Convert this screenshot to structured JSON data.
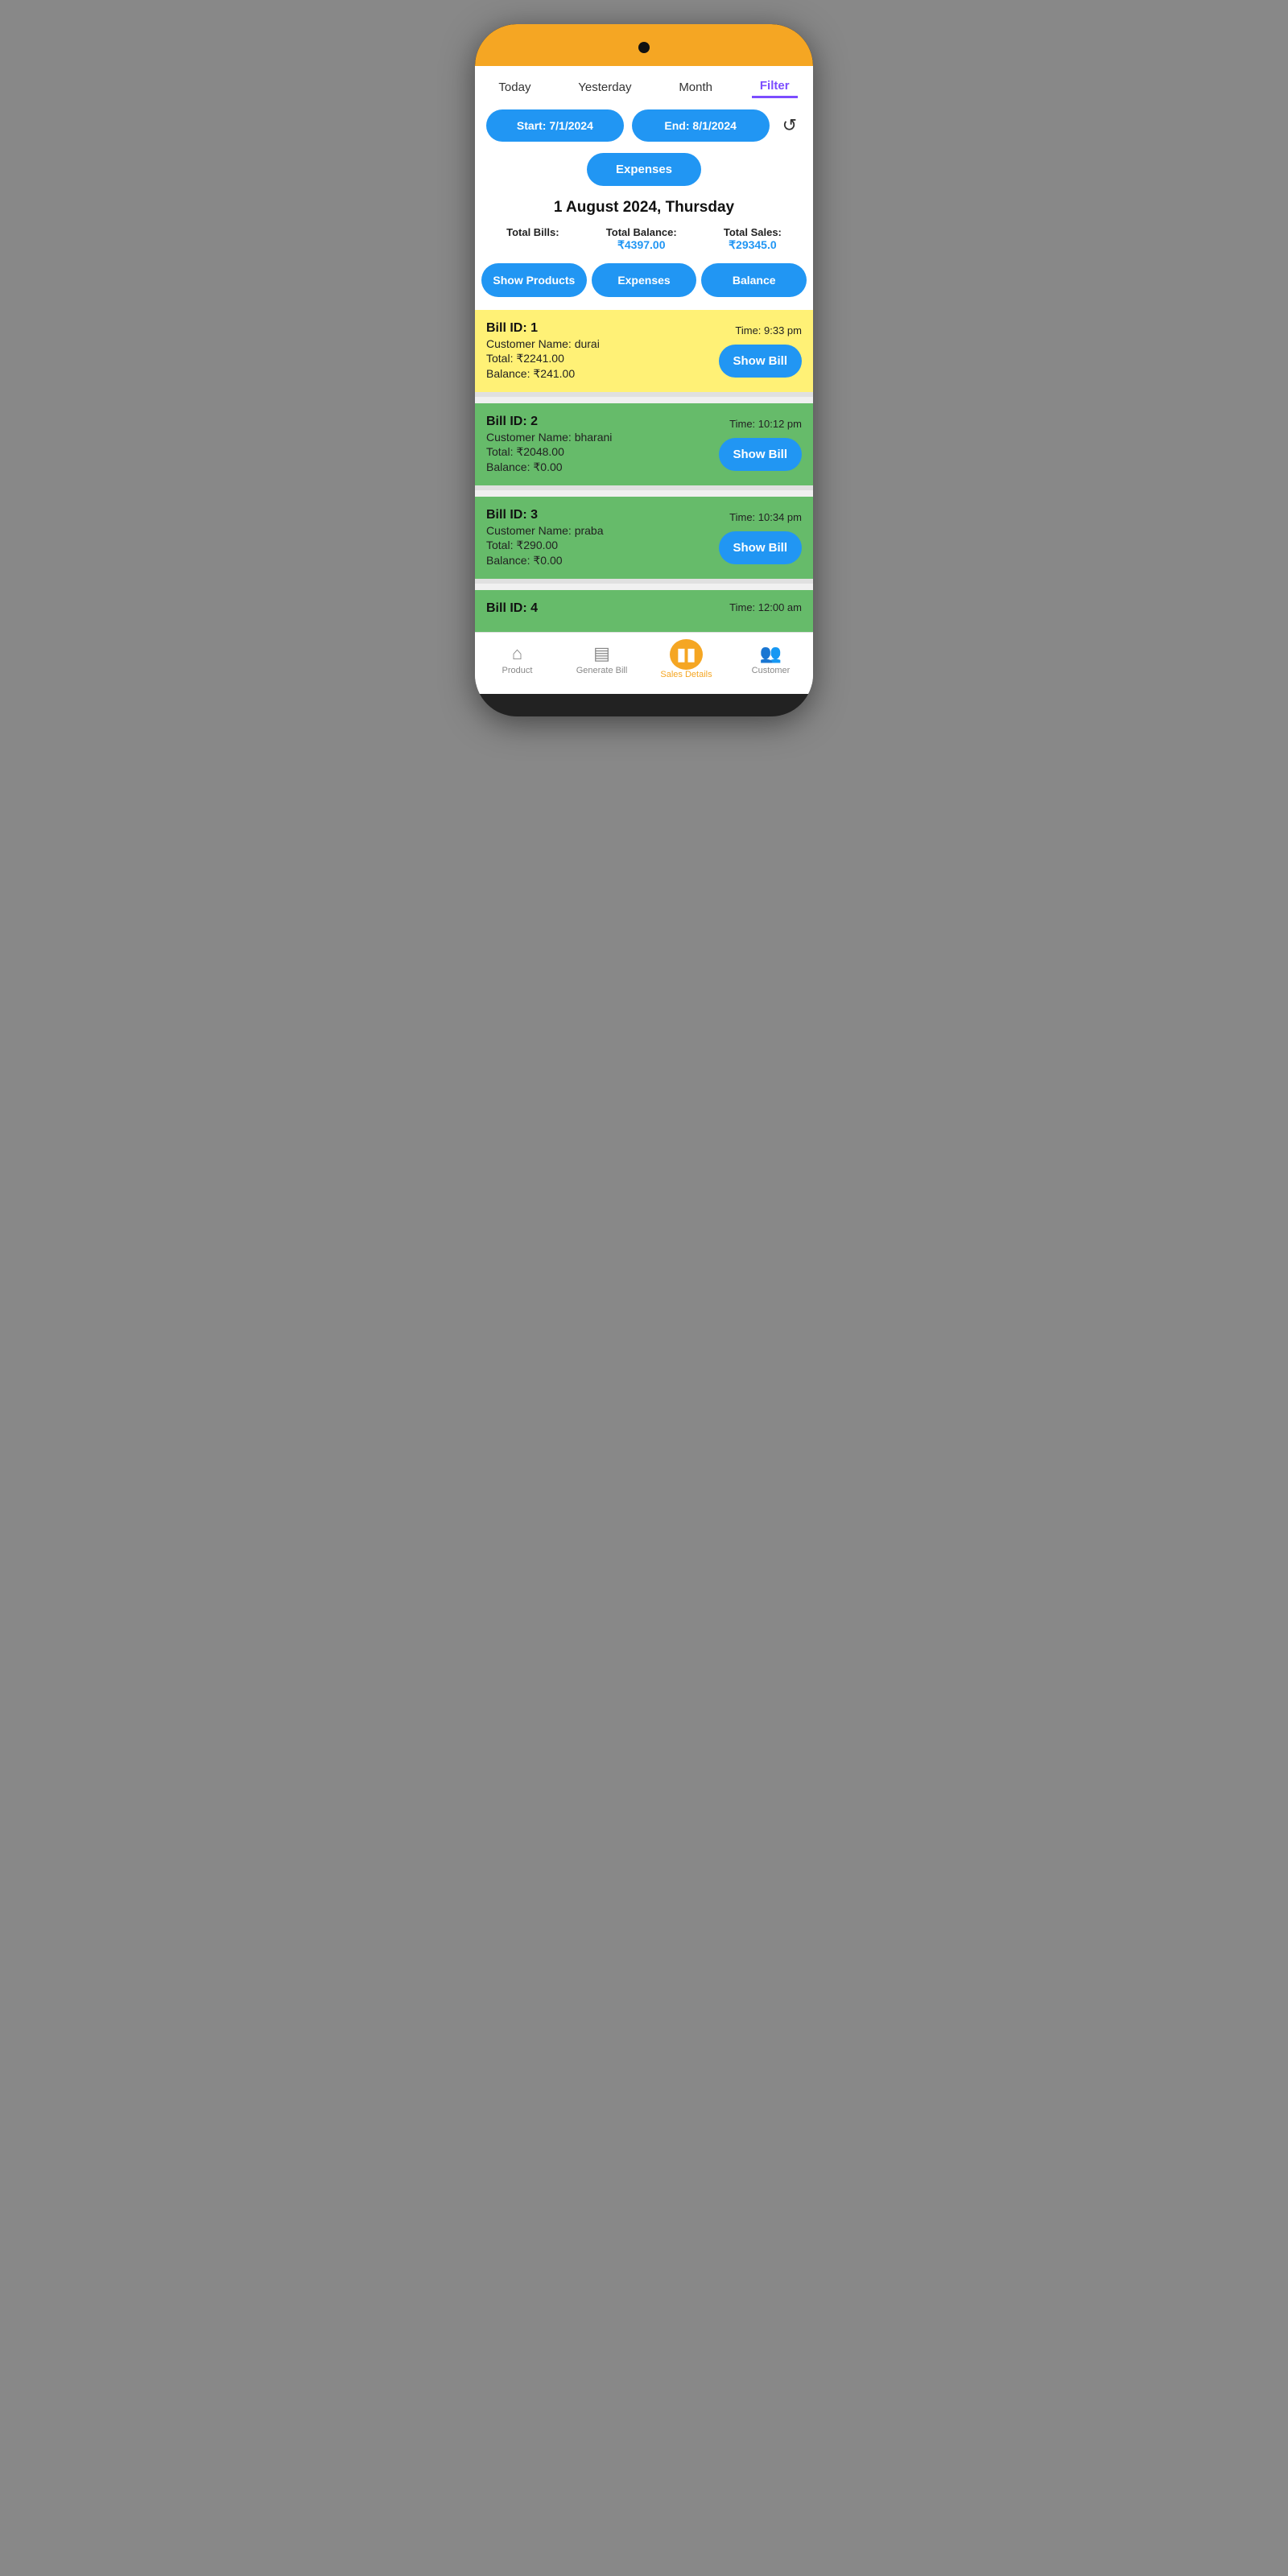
{
  "tabs": {
    "items": [
      "Today",
      "Yesterday",
      "Month",
      "Filter"
    ],
    "active": "Filter"
  },
  "filter": {
    "start_label": "Start: 7/1/2024",
    "end_label": "End: 8/1/2024",
    "refresh_icon": "↺"
  },
  "expenses_btn": "Expenses",
  "date_heading": "1 August 2024, Thursday",
  "stats": [
    {
      "label": "Total Bills:",
      "value": ""
    },
    {
      "label": "Total Balance:",
      "value": "₹4397.00"
    },
    {
      "label": "Total Sales:",
      "value": "₹29345.0"
    }
  ],
  "action_buttons": [
    "Show Products",
    "Expenses",
    "Balance"
  ],
  "bills": [
    {
      "id": "Bill ID: 1",
      "time": "Time: 9:33 pm",
      "customer": "Customer Name: durai",
      "total": "Total: ₹2241.00",
      "balance": "Balance: ₹241.00",
      "color": "yellow",
      "show_bill": "Show Bill"
    },
    {
      "id": "Bill ID: 2",
      "time": "Time: 10:12 pm",
      "customer": "Customer Name: bharani",
      "total": "Total: ₹2048.00",
      "balance": "Balance: ₹0.00",
      "color": "green",
      "show_bill": "Show Bill"
    },
    {
      "id": "Bill ID: 3",
      "time": "Time: 10:34 pm",
      "customer": "Customer Name: praba",
      "total": "Total: ₹290.00",
      "balance": "Balance: ₹0.00",
      "color": "green",
      "show_bill": "Show Bill"
    },
    {
      "id": "Bill ID: 4",
      "time": "Time: 12:00 am",
      "customer": "",
      "total": "",
      "balance": "",
      "color": "green",
      "show_bill": "",
      "partial": true
    }
  ],
  "bottom_nav": [
    {
      "icon": "⌂",
      "label": "Product",
      "active": false
    },
    {
      "icon": "▤",
      "label": "Generate Bill",
      "active": false
    },
    {
      "icon": "▮▮",
      "label": "Sales Details",
      "active": true
    },
    {
      "icon": "👥",
      "label": "Customer",
      "active": false
    }
  ]
}
